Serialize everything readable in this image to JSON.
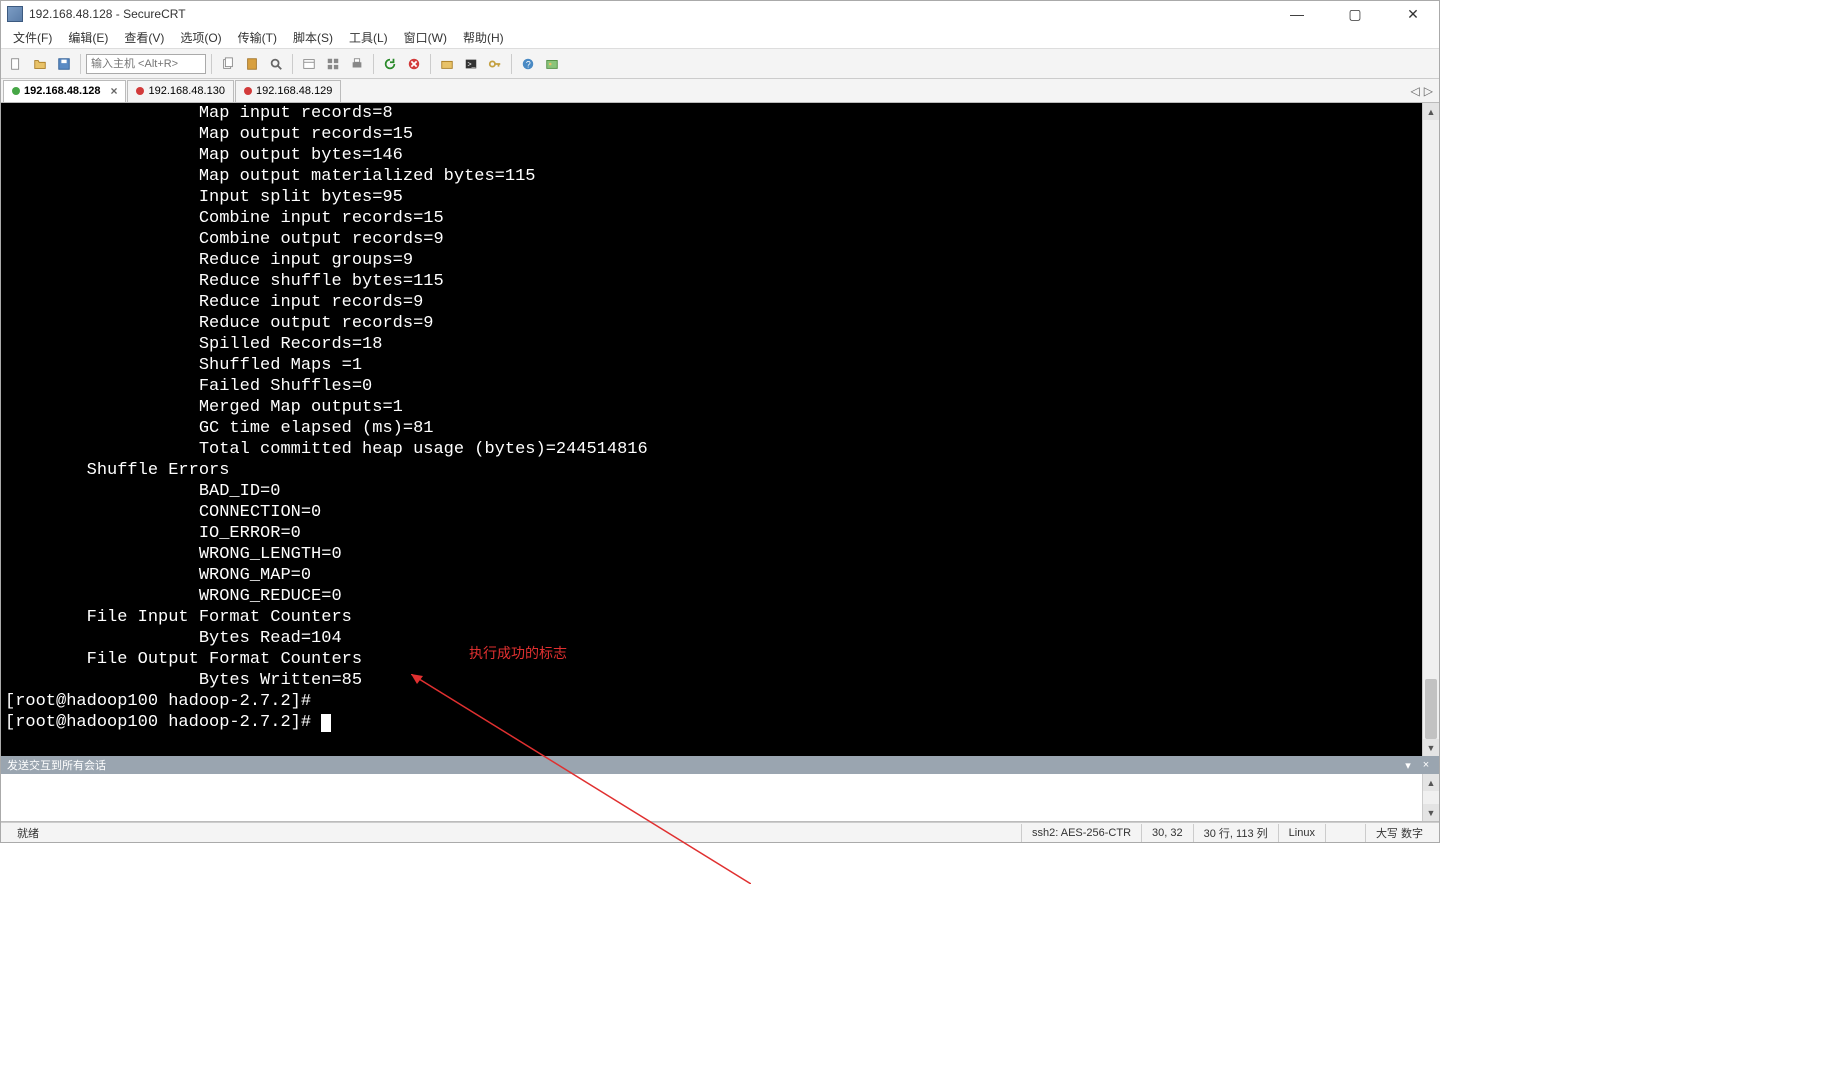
{
  "titlebar": {
    "title": "192.168.48.128 - SecureCRT"
  },
  "menubar": {
    "items": [
      "文件(F)",
      "编辑(E)",
      "查看(V)",
      "选项(O)",
      "传输(T)",
      "脚本(S)",
      "工具(L)",
      "窗口(W)",
      "帮助(H)"
    ]
  },
  "toolbar": {
    "host_placeholder": "输入主机 <Alt+R>",
    "icons": [
      "file-icon",
      "folder-icon",
      "save-icon",
      "host-input",
      "copy-icon",
      "paste-icon",
      "find-icon",
      "sep",
      "props-icon",
      "session-icon",
      "print-icon",
      "sep",
      "reconnect-icon",
      "disconnect-icon",
      "sep",
      "sftp-icon",
      "cmd-icon",
      "key-icon",
      "sep",
      "help-icon",
      "image-icon"
    ]
  },
  "tabs": [
    {
      "label": "192.168.48.128",
      "status": "green",
      "active": true,
      "closable": true
    },
    {
      "label": "192.168.48.130",
      "status": "red",
      "active": false
    },
    {
      "label": "192.168.48.129",
      "status": "red",
      "active": false
    }
  ],
  "terminal": {
    "lines": [
      "                   Map input records=8",
      "                   Map output records=15",
      "                   Map output bytes=146",
      "                   Map output materialized bytes=115",
      "                   Input split bytes=95",
      "                   Combine input records=15",
      "                   Combine output records=9",
      "                   Reduce input groups=9",
      "                   Reduce shuffle bytes=115",
      "                   Reduce input records=9",
      "                   Reduce output records=9",
      "                   Spilled Records=18",
      "                   Shuffled Maps =1",
      "                   Failed Shuffles=0",
      "                   Merged Map outputs=1",
      "                   GC time elapsed (ms)=81",
      "                   Total committed heap usage (bytes)=244514816",
      "        Shuffle Errors",
      "                   BAD_ID=0",
      "                   CONNECTION=0",
      "                   IO_ERROR=0",
      "                   WRONG_LENGTH=0",
      "                   WRONG_MAP=0",
      "                   WRONG_REDUCE=0",
      "        File Input Format Counters",
      "                   Bytes Read=104",
      "        File Output Format Counters",
      "                   Bytes Written=85",
      "[root@hadoop100 hadoop-2.7.2]#",
      "[root@hadoop100 hadoop-2.7.2]# "
    ]
  },
  "annotation": {
    "text": "执行成功的标志"
  },
  "sendpanel": {
    "header": "发送交互到所有会话"
  },
  "statusbar": {
    "ready": "就绪",
    "conn": "ssh2: AES-256-CTR",
    "cursor": "30, 32",
    "size": "30 行, 113 列",
    "term": "Linux",
    "caps": "大写 数字"
  },
  "winbtns": {
    "min": "—",
    "max": "▢",
    "close": "✕"
  }
}
